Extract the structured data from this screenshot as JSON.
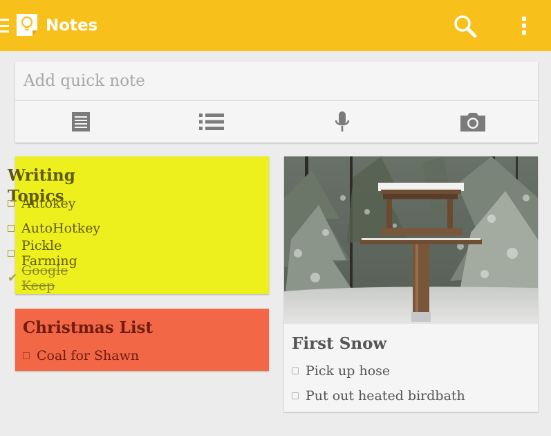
{
  "app": {
    "title": "Notes",
    "icons": [
      "menu-icon",
      "keep-bulb-icon",
      "search-icon",
      "more-vert-icon"
    ],
    "colors": {
      "appbar": "#f8c01a",
      "background": "#ececec"
    }
  },
  "quick_note": {
    "placeholder": "Add quick note",
    "actions": [
      {
        "name": "text-note",
        "icon": "text-note-icon"
      },
      {
        "name": "list-note",
        "icon": "list-icon"
      },
      {
        "name": "voice-note",
        "icon": "microphone-icon"
      },
      {
        "name": "photo-note",
        "icon": "camera-icon"
      }
    ]
  },
  "notes": [
    {
      "title": "Writing Topics",
      "color": "#eef01e",
      "items": [
        {
          "text": "Autokey",
          "checked": false
        },
        {
          "text": "AutoHotkey",
          "checked": false
        },
        {
          "text": "Pickle Farming",
          "checked": false
        },
        {
          "text": "Google Keep",
          "checked": true
        }
      ]
    },
    {
      "title": "Christmas List",
      "color": "#f26746",
      "items": [
        {
          "text": "Coal for Shawn",
          "checked": false
        }
      ]
    },
    {
      "title": "First Snow",
      "color": "#f5f5f5",
      "image": "snowy-birdfeeder-photo",
      "items": [
        {
          "text": "Pick up hose",
          "checked": false
        },
        {
          "text": "Put out heated birdbath",
          "checked": false
        }
      ]
    }
  ]
}
